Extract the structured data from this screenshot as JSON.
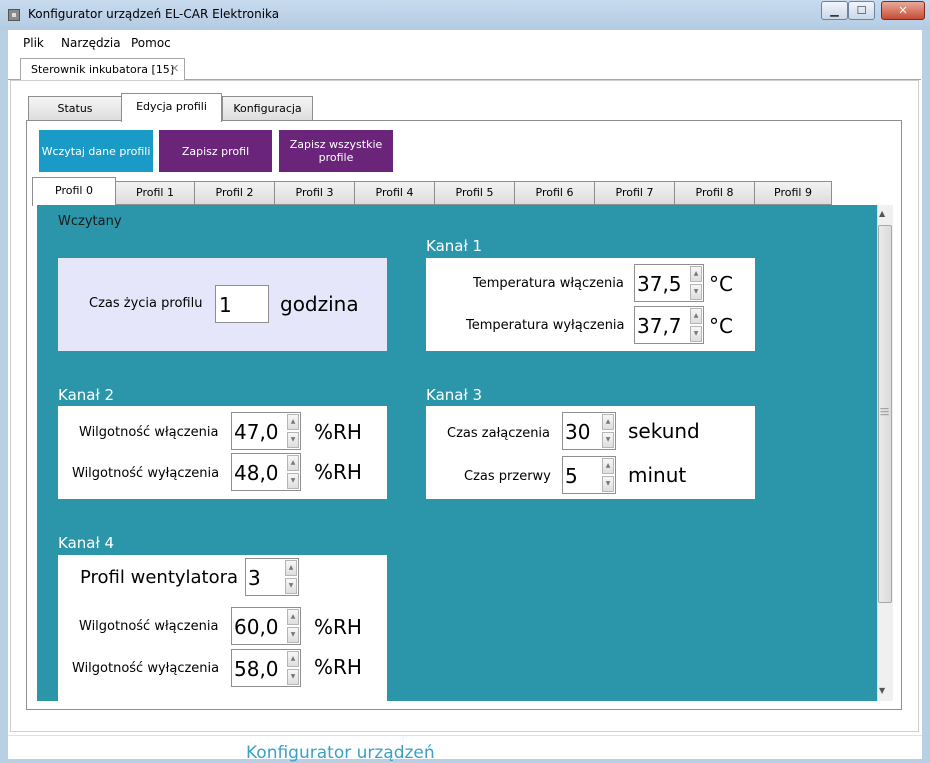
{
  "window": {
    "title": "Konfigurator urządzeń EL-CAR Elektronika",
    "close_glyph": "✕",
    "minimize_glyph": "▁",
    "maximize_glyph": "☐"
  },
  "menu": [
    "Plik",
    "Narzędzia",
    "Pomoc"
  ],
  "doc_tab": {
    "label": "Sterownik inkubatora [15]",
    "close_glyph": "✕"
  },
  "outer_tabs": [
    "Status",
    "Edycja profili",
    "Konfiguracja"
  ],
  "actions": {
    "load": "Wczytaj dane profili",
    "save": "Zapisz profil",
    "save_all": "Zapisz wszystkie profile"
  },
  "colors": {
    "load": "#1a9ac7",
    "save": "#6a257b",
    "panel": "#2b95a9"
  },
  "profile_tabs": [
    "Profil 0",
    "Profil 1",
    "Profil 2",
    "Profil 3",
    "Profil 4",
    "Profil 5",
    "Profil 6",
    "Profil 7",
    "Profil 8",
    "Profil 9"
  ],
  "status": "Wczytany",
  "lifetime": {
    "label": "Czas życia profilu",
    "value": "1",
    "unit": "godzina"
  },
  "kanal1": {
    "title": "Kanał 1",
    "on_label": "Temperatura włączenia",
    "on_value": "37,5",
    "on_unit": "°C",
    "off_label": "Temperatura wyłączenia",
    "off_value": "37,7",
    "off_unit": "°C"
  },
  "kanal2": {
    "title": "Kanał 2",
    "on_label": "Wilgotność włączenia",
    "on_value": "47,0",
    "on_unit": "%RH",
    "off_label": "Wilgotność wyłączenia",
    "off_value": "48,0",
    "off_unit": "%RH"
  },
  "kanal3": {
    "title": "Kanał 3",
    "on_label": "Czas załączenia",
    "on_value": "30",
    "on_unit": "sekund",
    "off_label": "Czas przerwy",
    "off_value": "5",
    "off_unit": "minut"
  },
  "kanal4": {
    "title": "Kanał 4",
    "fan_label": "Profil wentylatora",
    "fan_value": "3",
    "on_label": "Wilgotność włączenia",
    "on_value": "60,0",
    "on_unit": "%RH",
    "off_label": "Wilgotność wyłączenia",
    "off_value": "58,0",
    "off_unit": "%RH"
  },
  "spin_glyphs": {
    "up": "▲",
    "down": "▼"
  },
  "footer": "Konfigurator urządzeń"
}
